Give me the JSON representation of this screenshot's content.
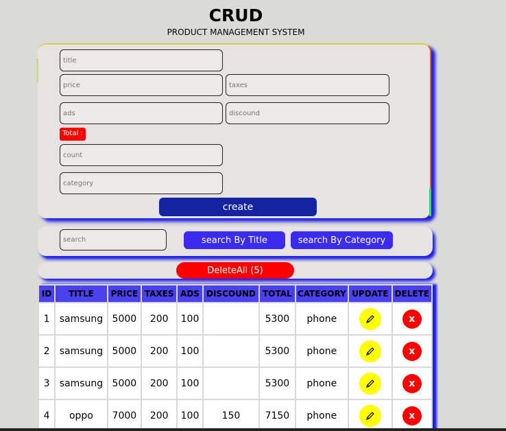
{
  "header": {
    "title": "CRUD",
    "subtitle": "PRODUCT MANAGEMENT SYSTEM"
  },
  "form": {
    "title_placeholder": "title",
    "price_placeholder": "price",
    "taxes_placeholder": "taxes",
    "ads_placeholder": "ads",
    "discount_placeholder": "discound",
    "total_label": "Total :",
    "count_placeholder": "count",
    "category_placeholder": "category",
    "create_label": "create"
  },
  "search": {
    "placeholder": "search",
    "by_title_label": "search By Title",
    "by_category_label": "search By Category"
  },
  "delete_all_label": "DeleteAll (5)",
  "table": {
    "headers": [
      "ID",
      "TITLE",
      "PRICE",
      "TAXES",
      "ADS",
      "DISCOUND",
      "TOTAL",
      "CATEGORY",
      "UPDATE",
      "DELETE"
    ],
    "delete_symbol": "x",
    "rows": [
      {
        "id": "1",
        "title": "samsung",
        "price": "5000",
        "taxes": "200",
        "ads": "100",
        "discount": "",
        "total": "5300",
        "category": "phone"
      },
      {
        "id": "2",
        "title": "samsung",
        "price": "5000",
        "taxes": "200",
        "ads": "100",
        "discount": "",
        "total": "5300",
        "category": "phone"
      },
      {
        "id": "3",
        "title": "samsung",
        "price": "5000",
        "taxes": "200",
        "ads": "100",
        "discount": "",
        "total": "5300",
        "category": "phone"
      },
      {
        "id": "4",
        "title": "oppo",
        "price": "7000",
        "taxes": "200",
        "ads": "100",
        "discount": "150",
        "total": "7150",
        "category": "phone"
      }
    ]
  },
  "colors": {
    "accent_blue": "#3a2bee",
    "create_blue": "#1424a0",
    "danger_red": "#ff0000",
    "update_yellow": "#ffff00"
  },
  "icons": {
    "update": "pencil-icon",
    "delete": "close-icon"
  }
}
